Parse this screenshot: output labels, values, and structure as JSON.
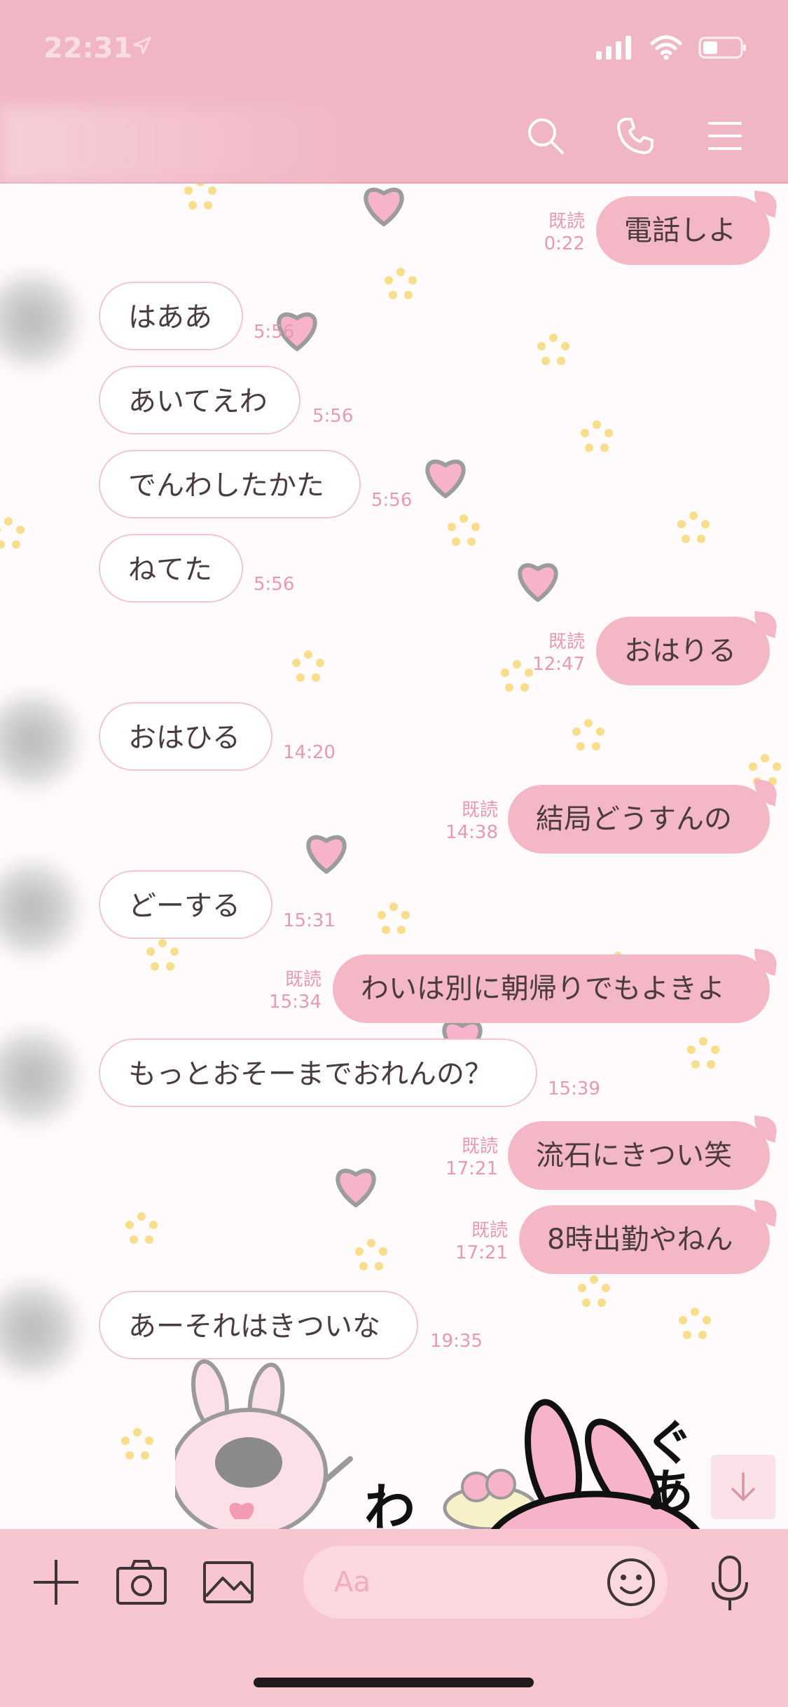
{
  "status": {
    "time": "22:31"
  },
  "input": {
    "placeholder": "Aa"
  },
  "colors": {
    "header": "#f1b6c4",
    "bubble_out": "#f4b7c5",
    "bubble_in": "#ffffff",
    "meta": "#e89aae"
  },
  "messages": [
    {
      "side": "out",
      "text": "電話しよ",
      "read": "既読",
      "time": "0:22"
    },
    {
      "side": "in",
      "text": "はああ",
      "time": "5:56"
    },
    {
      "side": "in",
      "text": "あいてえわ",
      "time": "5:56"
    },
    {
      "side": "in",
      "text": "でんわしたかた",
      "time": "5:56"
    },
    {
      "side": "in",
      "text": "ねてた",
      "time": "5:56"
    },
    {
      "side": "out",
      "text": "おはりる",
      "read": "既読",
      "time": "12:47"
    },
    {
      "side": "in",
      "text": "おはひる",
      "time": "14:20"
    },
    {
      "side": "out",
      "text": "結局どうすんの",
      "read": "既読",
      "time": "14:38"
    },
    {
      "side": "in",
      "text": "どーする",
      "time": "15:31"
    },
    {
      "side": "out",
      "text": "わいは別に朝帰りでもよきよ",
      "read": "既読",
      "time": "15:34"
    },
    {
      "side": "in",
      "text": "もっとおそーまでおれんの？",
      "time": "15:39"
    },
    {
      "side": "out",
      "text": "流石にきつい笑",
      "read": "既読",
      "time": "17:21"
    },
    {
      "side": "out",
      "text": "8時出勤やねん",
      "read": "既読",
      "time": "17:21"
    },
    {
      "side": "in",
      "text": "あーそれはきついな",
      "time": "19:35"
    }
  ],
  "sticker": {
    "text_left": "わる",
    "text_right": "ぐあ"
  },
  "icons": {
    "header": [
      "search-icon",
      "phone-icon",
      "menu-icon"
    ],
    "input": [
      "plus-icon",
      "camera-icon",
      "image-icon",
      "emoji-icon",
      "mic-icon"
    ],
    "scroll": "arrow-down-icon"
  }
}
